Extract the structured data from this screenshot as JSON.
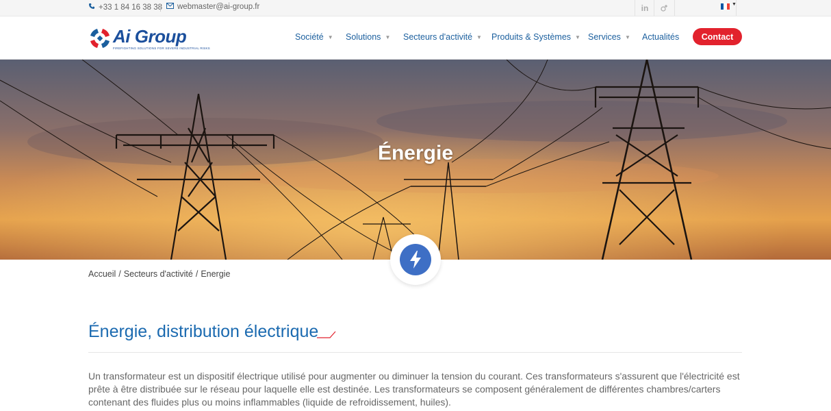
{
  "topbar": {
    "phone": "+33 1 84 16 38 38",
    "email": "webmaster@ai-group.fr",
    "social": [
      "linkedin-icon",
      "google-plus-icon"
    ],
    "language": "fr"
  },
  "logo": {
    "name": "Ai Group",
    "tagline": "FIREFIGHTING SOLUTIONS FOR SEVERE INDUSTRIAL RISKS"
  },
  "nav": {
    "items": [
      {
        "label": "Société",
        "dropdown": true
      },
      {
        "label": "Solutions",
        "dropdown": true
      },
      {
        "label": "Secteurs d'activité",
        "dropdown": true
      },
      {
        "label": "Produits & Systèmes",
        "dropdown": true
      },
      {
        "label": "Services",
        "dropdown": true
      },
      {
        "label": "Actualités",
        "dropdown": false
      }
    ],
    "contact_label": "Contact"
  },
  "hero": {
    "title": "Énergie",
    "badge_icon": "lightning-bolt-icon"
  },
  "breadcrumb": {
    "items": [
      "Accueil",
      "Secteurs d'activité",
      "Energie"
    ],
    "separator": "/"
  },
  "content": {
    "title": "Énergie, distribution électrique",
    "paragraph": "Un transformateur est un dispositif électrique utilisé pour augmenter ou diminuer la tension du courant. Ces transformateurs s'assurent que l'électricité est prête à être distribuée sur le réseau pour laquelle elle est destinée. Les transformateurs se composent généralement de différentes chambres/carters contenant des fluides plus ou moins inflammables (liquide de refroidissement, huiles)."
  },
  "colors": {
    "brand_blue": "#1b5f9e",
    "contact_red": "#e2222d",
    "title_blue": "#1b6ab0",
    "badge_blue": "#3e6fc5"
  }
}
